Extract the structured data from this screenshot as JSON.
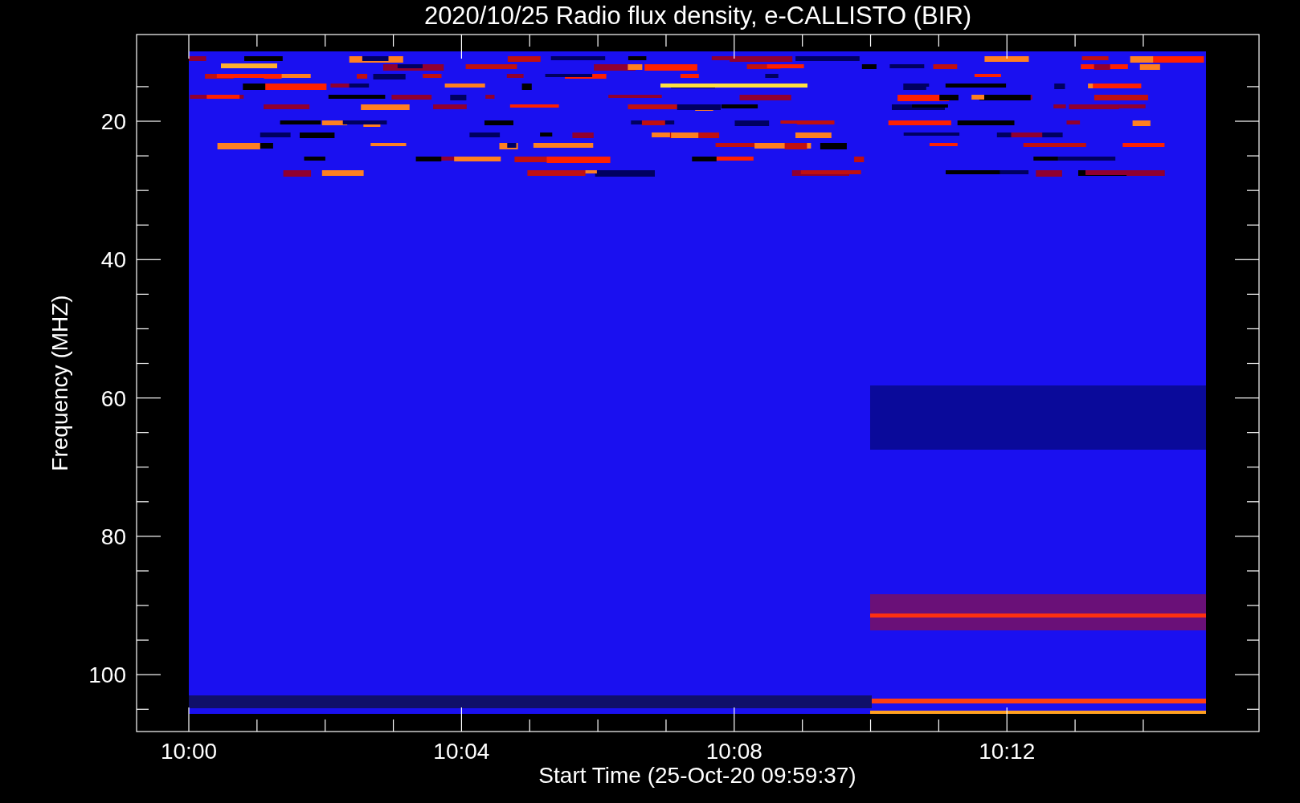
{
  "title": "2020/10/25  Radio flux density, e-CALLISTO (BIR)",
  "y_axis": {
    "label": "Frequency (MHZ)",
    "ticks": [
      "20",
      "40",
      "60",
      "80",
      "100"
    ]
  },
  "x_axis": {
    "label": "Start Time (25-Oct-20 09:59:37)",
    "ticks": [
      "10:00",
      "10:04",
      "10:08",
      "10:12"
    ]
  }
}
